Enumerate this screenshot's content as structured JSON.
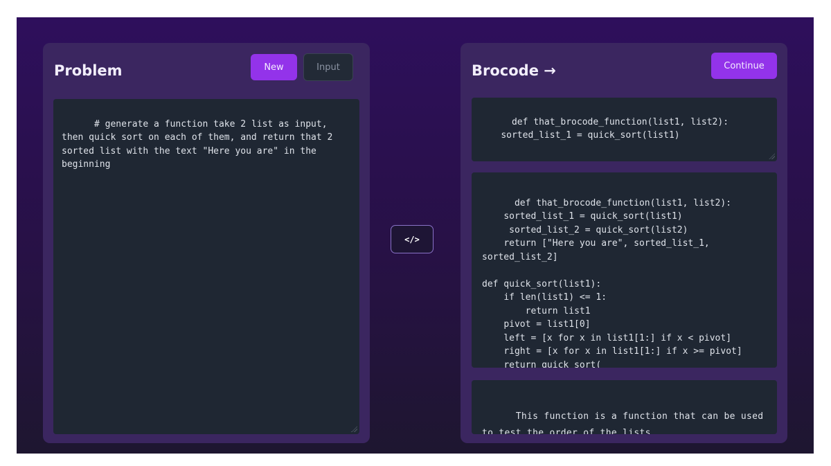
{
  "problem": {
    "title": "Problem",
    "new_label": "New",
    "input_label": "Input",
    "prompt_text": "# generate a function take 2 list as input, then quick sort on each of them, and return that 2 sorted list with the text \"Here you are\" in the beginning"
  },
  "convert_icon": "code-icon",
  "convert_glyph": "</>",
  "brocode": {
    "title": "Brocode",
    "arrow": "→",
    "continue_label": "Continue",
    "partial_code": "def that_brocode_function(list1, list2):\n    sorted_list_1 = quick_sort(list1)",
    "full_code": "def that_brocode_function(list1, list2):\n    sorted_list_1 = quick_sort(list1)\n     sorted_list_2 = quick_sort(list2)\n    return [\"Here you are\", sorted_list_1,\nsorted_list_2]\n\ndef quick_sort(list1):\n    if len(list1) <= 1:\n        return list1\n    pivot = list1[0]\n    left = [x for x in list1[1:] if x < pivot]\n    right = [x for x in list1[1:] if x >= pivot]\n    return quick_sort(",
    "explanation": "This function is a function that can be used to test the order of the lists"
  },
  "colors": {
    "accent": "#9333ea",
    "panel": "#3b2660",
    "code_bg": "#1f2733"
  }
}
